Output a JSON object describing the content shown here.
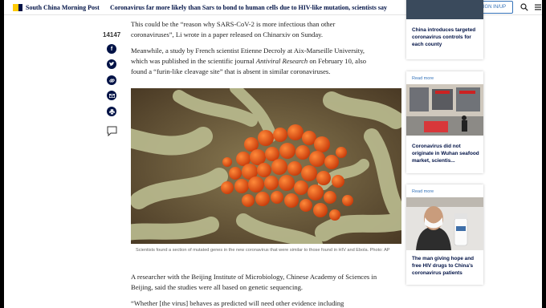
{
  "header": {
    "site_name": "South China Morning Post",
    "headline": "Coronavirus far more likely than Sars to bond to human cells due to HIV-like mutation, scientists say",
    "signin_label": "SIGN IN/UP"
  },
  "share": {
    "count": "14147",
    "icons": [
      "facebook-icon",
      "twitter-icon",
      "link-icon",
      "email-icon",
      "print-icon",
      "comment-icon"
    ]
  },
  "article": {
    "para1_line1": "This could be the “reason why SARS-CoV-2 is more infectious than other",
    "para1_line2": "coronaviruses”, Li wrote in a paper released on Chinarxiv on Sunday.",
    "para2_line1": "Meanwhile, a study by French scientist Etienne Decroly at Aix-Marseille University,",
    "para2_line2_pre": "which was published in the scientific journal ",
    "para2_line2_journal": "Antiviral Research",
    "para2_line2_post": " on February 10, also",
    "para2_line3": "found a “furin-like cleavage site” that is absent in similar coronaviruses.",
    "caption": "Scientists found a section of mutated genes in the new coronavirus that were similar to those found in HIV and Ebola. Photo: AP",
    "para3_line1": "A researcher with the Beijing Institute of Microbiology, Chinese Academy of Sciences in",
    "para3_line2": "Beijing, said the studies were all based on genetic sequencing.",
    "para4_line1": "“Whether [the virus] behaves as predicted will need other evidence including"
  },
  "sidebar": {
    "card1_title": "China introduces targeted coronavirus controls for each county",
    "card2_more": "Read more",
    "card2_title": "Coronavirus did not originate in Wuhan seafood market, scientis...",
    "card3_more": "Read more",
    "card3_title": "The man giving hope and free HIV drugs to China’s coronavirus patients"
  },
  "colors": {
    "brand_navy": "#001246",
    "brand_yellow": "#ffca05",
    "link_blue": "#3573b9"
  }
}
